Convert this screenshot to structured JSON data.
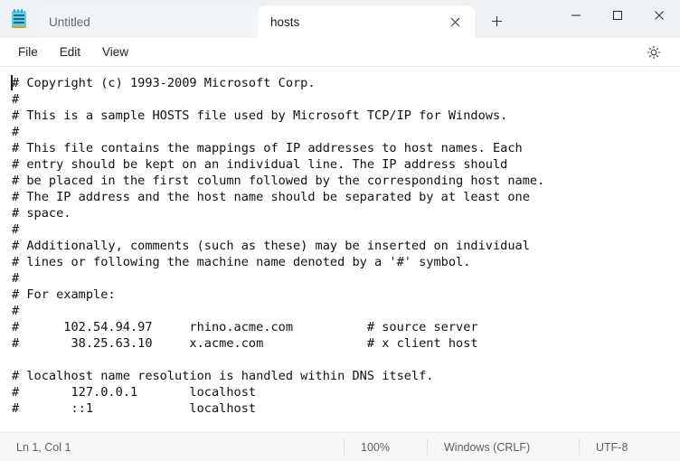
{
  "window": {
    "app_icon": "notepad-icon",
    "controls": {
      "minimize": "minimize-icon",
      "maximize": "maximize-icon",
      "close": "close-icon"
    }
  },
  "tabs": [
    {
      "label": "Untitled",
      "active": false,
      "has_icon": true
    },
    {
      "label": "hosts",
      "active": true,
      "has_close": true
    }
  ],
  "newtab": {
    "label": "+",
    "name": "new-tab-button"
  },
  "menubar": {
    "items": [
      {
        "label": "File"
      },
      {
        "label": "Edit"
      },
      {
        "label": "View"
      }
    ],
    "settings_icon": "gear-icon"
  },
  "editor": {
    "content": "# Copyright (c) 1993-2009 Microsoft Corp.\n#\n# This is a sample HOSTS file used by Microsoft TCP/IP for Windows.\n#\n# This file contains the mappings of IP addresses to host names. Each\n# entry should be kept on an individual line. The IP address should\n# be placed in the first column followed by the corresponding host name.\n# The IP address and the host name should be separated by at least one\n# space.\n#\n# Additionally, comments (such as these) may be inserted on individual\n# lines or following the machine name denoted by a '#' symbol.\n#\n# For example:\n#\n#      102.54.94.97     rhino.acme.com          # source server\n#       38.25.63.10     x.acme.com              # x client host\n\n# localhost name resolution is handled within DNS itself.\n#\t127.0.0.1       localhost\n#\t::1             localhost",
    "lines": [
      "# Copyright (c) 1993-2009 Microsoft Corp.",
      "#",
      "# This is a sample HOSTS file used by Microsoft TCP/IP for Windows.",
      "#",
      "# This file contains the mappings of IP addresses to host names. Each",
      "# entry should be kept on an individual line. The IP address should",
      "# be placed in the first column followed by the corresponding host name.",
      "# The IP address and the host name should be separated by at least one",
      "# space.",
      "#",
      "# Additionally, comments (such as these) may be inserted on individual",
      "# lines or following the machine name denoted by a '#' symbol.",
      "#",
      "# For example:",
      "#",
      "#      102.54.94.97     rhino.acme.com          # source server",
      "#       38.25.63.10     x.acme.com              # x client host",
      "",
      "# localhost name resolution is handled within DNS itself.",
      "#    127.0.0.1       localhost",
      "#    ::1             localhost"
    ]
  },
  "statusbar": {
    "position": "Ln 1, Col 1",
    "zoom": "100%",
    "line_ending": "Windows (CRLF)",
    "encoding": "UTF-8"
  }
}
